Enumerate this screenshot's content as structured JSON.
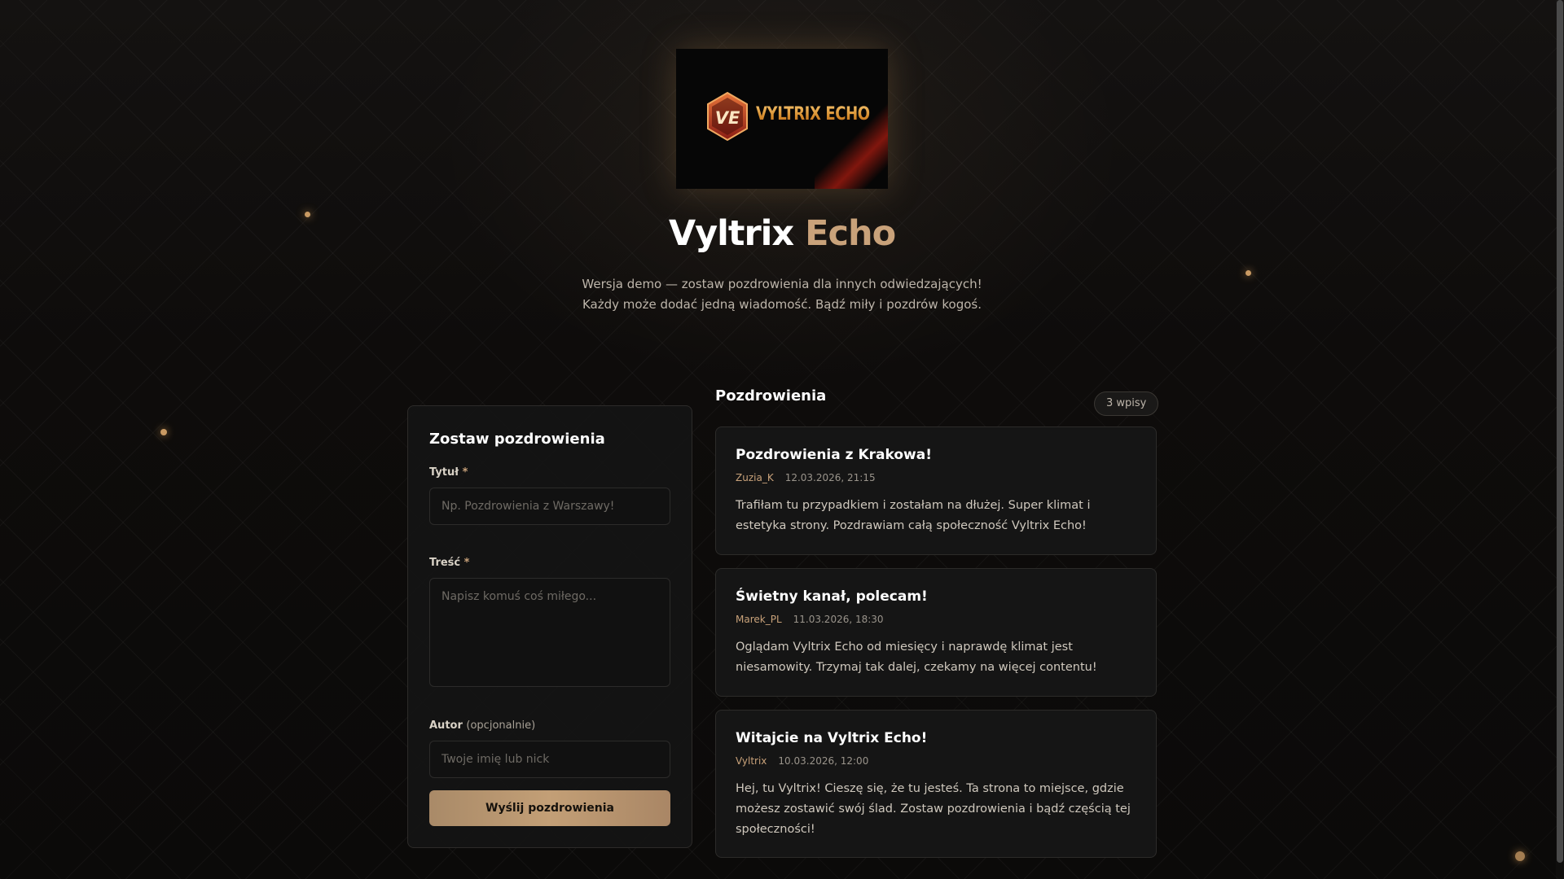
{
  "banner": {
    "logo_monogram": "VE",
    "logo_text": "VYLTRIX ECHO"
  },
  "hero": {
    "title_main": "Vyltrix",
    "title_accent": "Echo",
    "subtitle_line1": "Wersja demo — zostaw pozdrowienia dla innych odwiedzających!",
    "subtitle_line2": "Każdy może dodać jedną wiadomość. Bądź miły i pozdrów kogoś."
  },
  "form": {
    "title": "Zostaw pozdrowienia",
    "title_label": "Tytuł",
    "title_placeholder": "Np. Pozdrowienia z Warszawy!",
    "content_label": "Treść",
    "content_placeholder": "Napisz komuś coś miłego...",
    "author_label": "Autor",
    "author_optional": "(opcjonalnie)",
    "author_placeholder": "Twoje imię lub nick",
    "required_mark": "*",
    "submit_label": "Wyślij pozdrowienia"
  },
  "list": {
    "heading": "Pozdrowienia",
    "count_label": "3 wpisy",
    "entries": [
      {
        "title": "Pozdrowienia z Krakowa!",
        "author": "Zuzia_K",
        "date": "12.03.2026, 21:15",
        "body": "Trafiłam tu przypadkiem i zostałam na dłużej. Super klimat i estetyka strony. Pozdrawiam całą społeczność Vyltrix Echo!"
      },
      {
        "title": "Świetny kanał, polecam!",
        "author": "Marek_PL",
        "date": "11.03.2026, 18:30",
        "body": "Oglądam Vyltrix Echo od miesięcy i naprawdę klimat jest niesamowity. Trzymaj tak dalej, czekamy na więcej contentu!"
      },
      {
        "title": "Witajcie na Vyltrix Echo!",
        "author": "Vyltrix",
        "date": "10.03.2026, 12:00",
        "body": "Hej, tu Vyltrix! Cieszę się, że tu jesteś. Ta strona to miejsce, gdzie możesz zostawić swój ślad. Zostaw pozdrowienia i bądź częścią tej społeczności!"
      }
    ]
  },
  "colors": {
    "accent": "#c9a27a",
    "background": "#0d0b0a",
    "card": "#161616"
  }
}
